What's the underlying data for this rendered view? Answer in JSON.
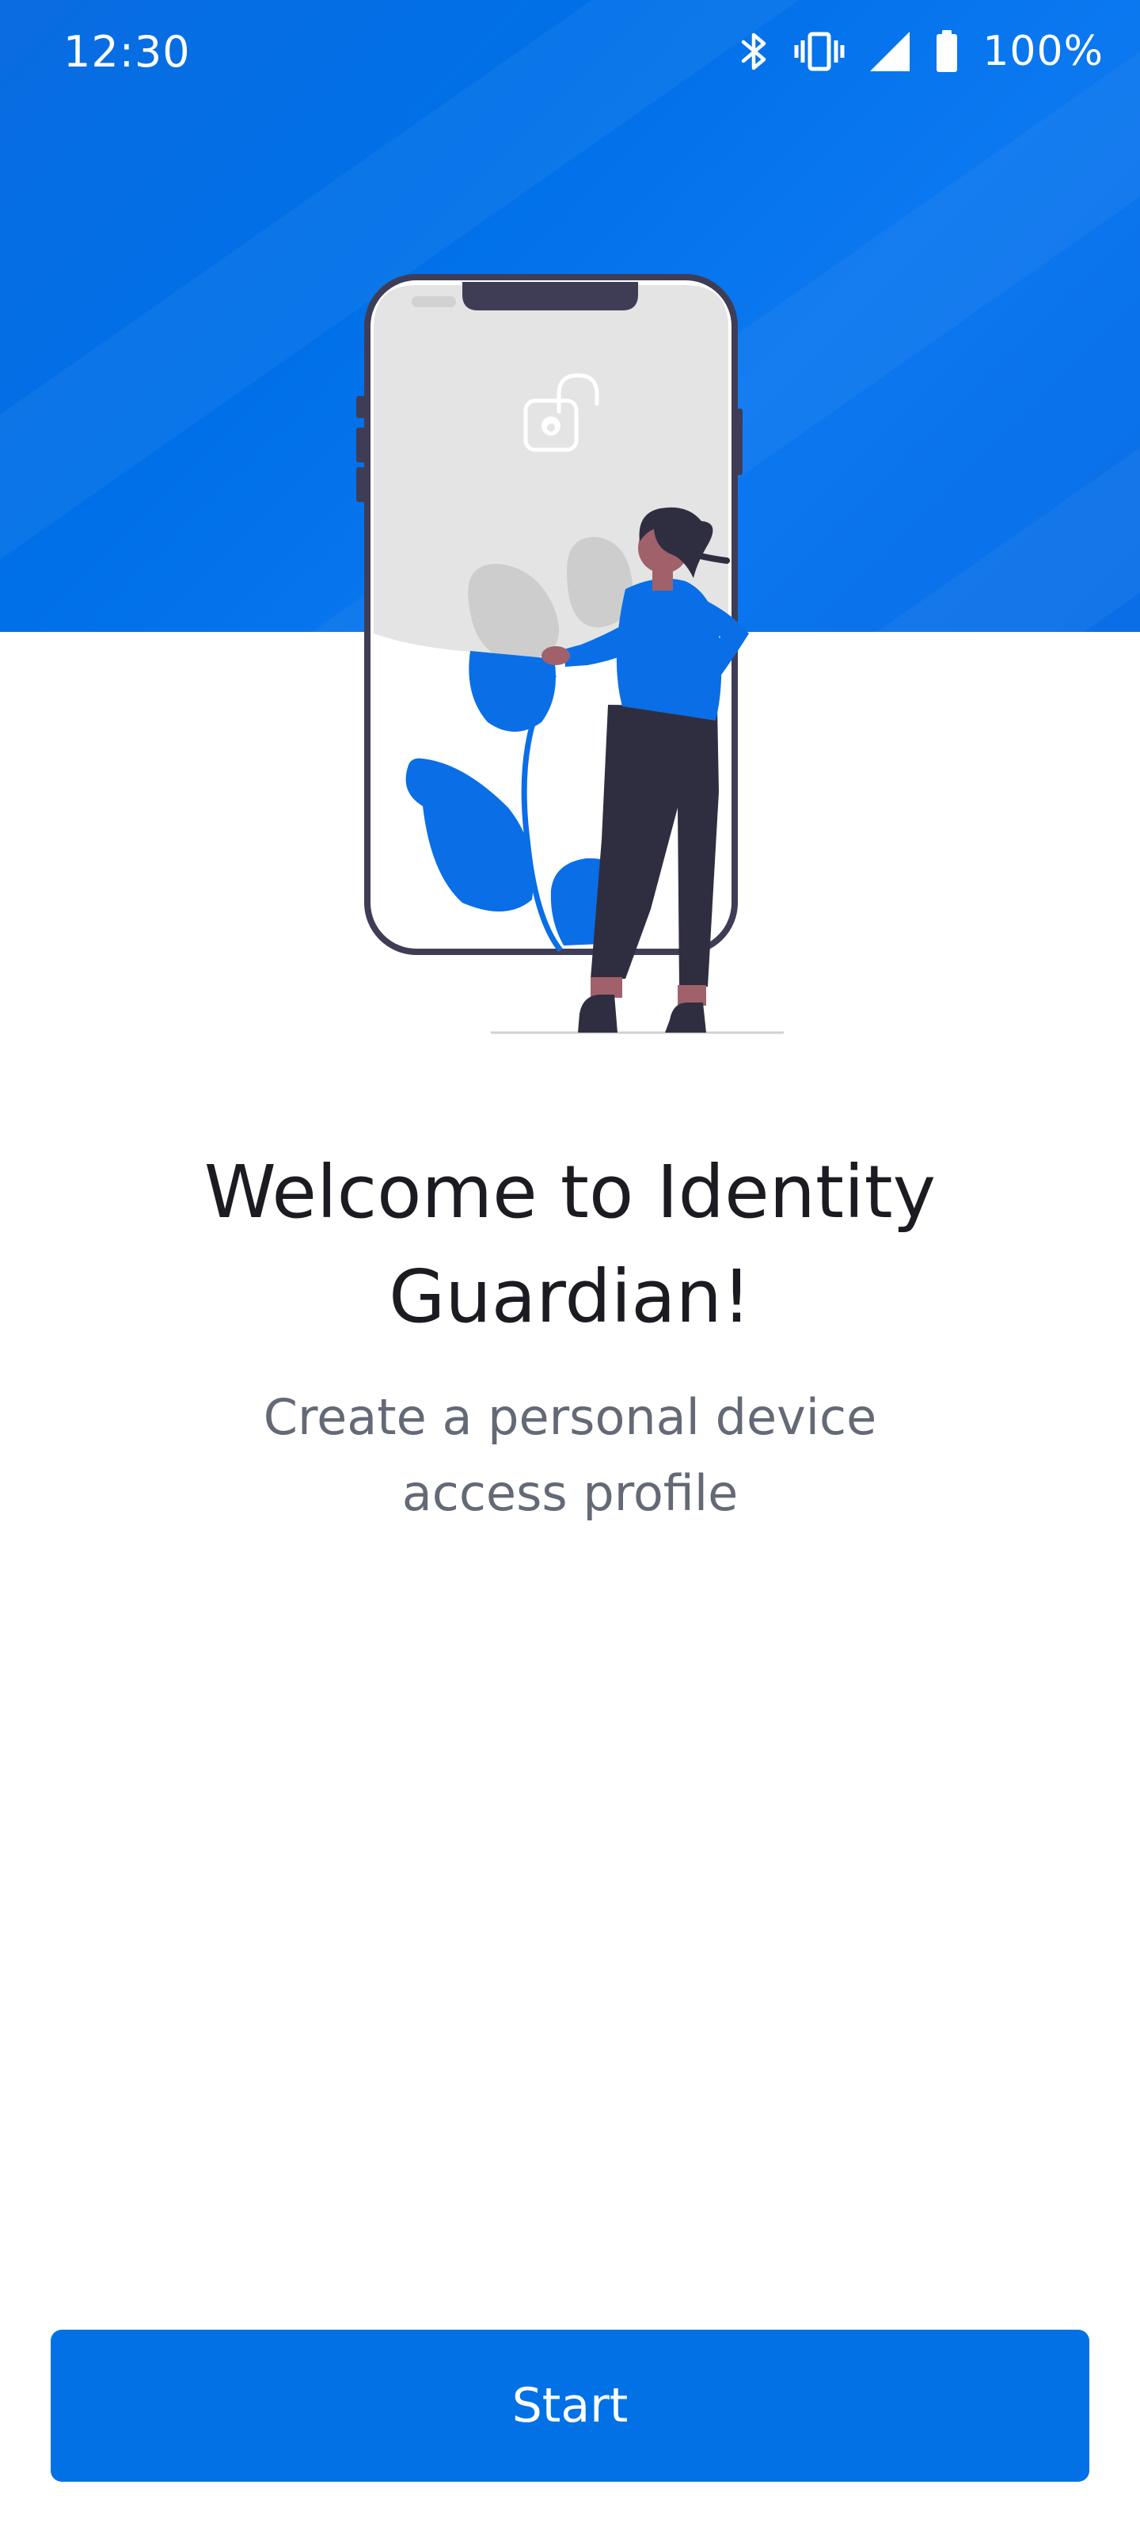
{
  "status_bar": {
    "time": "12:30",
    "battery_text": "100%",
    "icons": [
      "bluetooth-icon",
      "vibrate-icon",
      "signal-icon",
      "battery-icon"
    ]
  },
  "welcome": {
    "title": "Welcome to Identity Guardian!",
    "subtitle": "Create a personal device access profile"
  },
  "actions": {
    "start_label": "Start"
  },
  "colors": {
    "brand_blue": "#0271e6",
    "title_text": "#1b1b22",
    "subtitle_text": "#646a75",
    "figure_dark": "#2f2e41"
  }
}
